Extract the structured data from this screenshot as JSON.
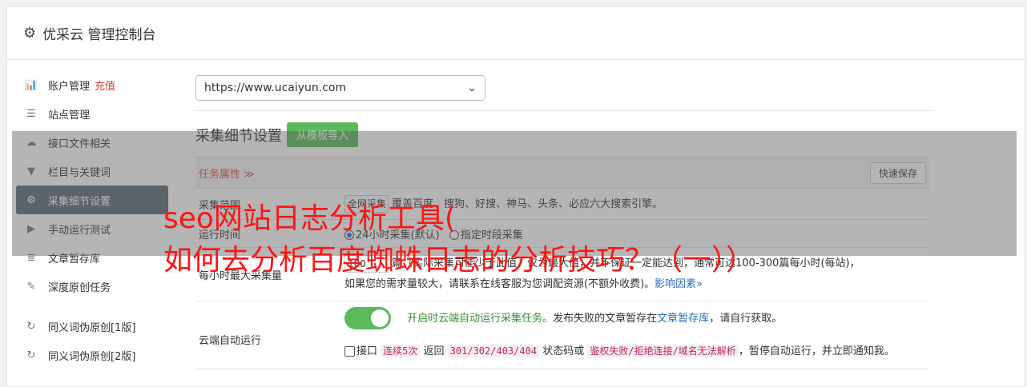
{
  "header": {
    "title": "优采云 管理控制台"
  },
  "sidebar": {
    "items": [
      {
        "icon": "bar-chart-icon",
        "glyph": "📊",
        "label": "账户管理",
        "extra": "充值"
      },
      {
        "icon": "server-icon",
        "glyph": "☰",
        "label": "站点管理"
      },
      {
        "icon": "cloud-upload-icon",
        "glyph": "☁",
        "label": "接口文件相关"
      },
      {
        "icon": "filter-icon",
        "glyph": "▼",
        "label": "栏目与关键词"
      },
      {
        "icon": "cogs-icon",
        "glyph": "⚙",
        "label": "采集细节设置",
        "active": true
      },
      {
        "icon": "play-circle-icon",
        "glyph": "▶",
        "label": "手动运行测试"
      },
      {
        "icon": "database-icon",
        "glyph": "≣",
        "label": "文章暂存库"
      },
      {
        "icon": "edit-icon",
        "glyph": "✎",
        "label": "深度原创任务"
      }
    ],
    "items2": [
      {
        "icon": "refresh-icon",
        "glyph": "↻",
        "label": "同义词伪原创[1版]"
      },
      {
        "icon": "refresh-icon",
        "glyph": "↻",
        "label": "同义词伪原创[2版]"
      }
    ]
  },
  "main": {
    "site_select": "https://www.ucaiyun.com",
    "section_title": "采集细节设置",
    "import_button": "从模板导入",
    "task_props_label": "任务属性 ≫",
    "quick_save": "快速保存",
    "rows": {
      "scope_label": "采集范围",
      "scope_input": "全网采集",
      "scope_text": "覆盖百度、搜狗、好搜、神马、头条、必应六大搜索引擎。",
      "runtime_label": "运行时间",
      "runtime_opt1": "24小时采集(默认)",
      "runtime_opt2": "指定时段采集",
      "max_label": "每小时最大采集量",
      "max_input": "100",
      "max_text1": "篇（实际采集可能少于此值，仅为最大值，并不保证一定能达到，通常可达100-300篇每小时(每站)，",
      "max_text2": "如果您的需求量较大，请联系在线客服为您调配资源(不额外收费)。",
      "max_link": "影响因素»",
      "cloud_label": "云端自动运行",
      "cloud_green": "开启时云端自动运行采集任务。",
      "cloud_text": "发布失败的文章暂存在",
      "cloud_link": "文章暂存库",
      "cloud_text2": "，请自行获取。",
      "iface_cb": "接口",
      "iface_code1": "连续5次",
      "iface_t1": "返回",
      "iface_code2": "301/302/403/404",
      "iface_t2": "状态码或",
      "iface_code3": "鉴权失败/拒绝连接/域名无法解析",
      "iface_t3": "，暂停自动运行，并立即通知我。"
    }
  },
  "overlay": {
    "line1": "seo网站日志分析工具(",
    "line2": "如何去分析百度蜘蛛日志的分析技巧？（一））"
  }
}
